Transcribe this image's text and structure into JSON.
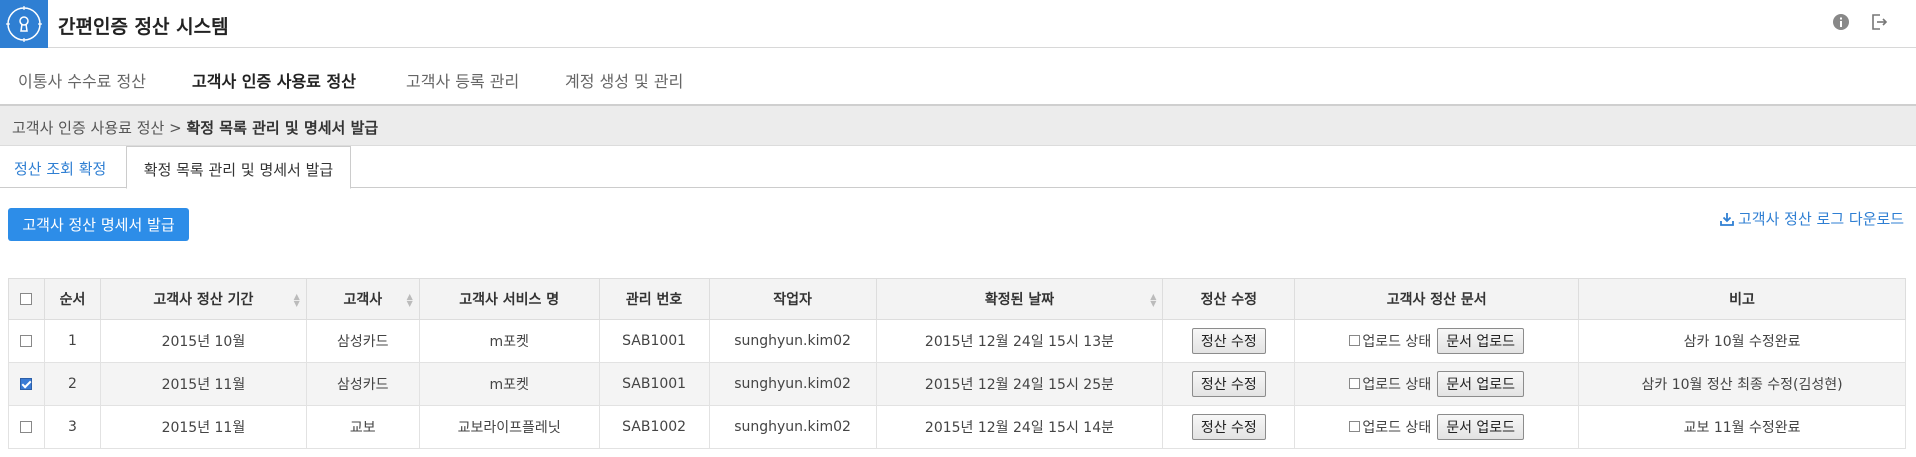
{
  "app": {
    "title": "간편인증 정산 시스템"
  },
  "nav": {
    "tabs": [
      {
        "label": "이통사 수수료 정산"
      },
      {
        "label": "고객사 인증 사용료 정산"
      },
      {
        "label": "고객사 등록 관리"
      },
      {
        "label": "계정 생성 및 관리"
      }
    ],
    "active_index": 1
  },
  "breadcrumb": {
    "parent": "고객사 인증 사용료 정산",
    "separator": ">",
    "current": "확정 목록 관리 및 명세서 발급"
  },
  "subtabs": [
    {
      "label": "정산 조회 확정"
    },
    {
      "label": "확정 목록 관리 및 명세서 발급"
    }
  ],
  "actions": {
    "issue_button": "고객사 정산 명세서 발급",
    "download_link": "고객사 정산 로그 다운로드"
  },
  "table": {
    "headers": {
      "index": "순서",
      "period": "고객사 정산 기간",
      "customer": "고객사",
      "service": "고객사 서비스 명",
      "mgmt_no": "관리 번호",
      "worker": "작업자",
      "confirmed_date": "확정된 날짜",
      "edit": "정산 수정",
      "document": "고객사 정산 문서",
      "note": "비고"
    },
    "rows": [
      {
        "index": "1",
        "checked": false,
        "period": "2015년 10월",
        "customer": "삼성카드",
        "service": "m포켓",
        "mgmt_no": "SAB1001",
        "worker": "sunghyun.kim02",
        "confirmed_date": "2015년 12월 24일 15시 13분",
        "edit_btn": "정산 수정",
        "upload_state": "업로드 상태",
        "upload_btn": "문서 업로드",
        "note": "삼카 10월 수정완료"
      },
      {
        "index": "2",
        "checked": true,
        "period": "2015년 11월",
        "customer": "삼성카드",
        "service": "m포켓",
        "mgmt_no": "SAB1001",
        "worker": "sunghyun.kim02",
        "confirmed_date": "2015년 12월 24일 15시 25분",
        "edit_btn": "정산 수정",
        "upload_state": "업로드 상태",
        "upload_btn": "문서 업로드",
        "note": "삼카 10월 정산 최종 수정(김성현)"
      },
      {
        "index": "3",
        "checked": false,
        "period": "2015년 11월",
        "customer": "교보",
        "service": "교보라이프플레닛",
        "mgmt_no": "SAB1002",
        "worker": "sunghyun.kim02",
        "confirmed_date": "2015년 12월 24일 15시 14분",
        "edit_btn": "정산 수정",
        "upload_state": "업로드 상태",
        "upload_btn": "문서 업로드",
        "note": "교보 11월 수정완료"
      }
    ]
  },
  "colors": {
    "accent": "#2f7fd3",
    "button": "#2d8de8"
  },
  "icons": {
    "logo": "keyhole-clock-icon",
    "info": "info-icon",
    "logout": "logout-icon",
    "download": "download-icon"
  }
}
